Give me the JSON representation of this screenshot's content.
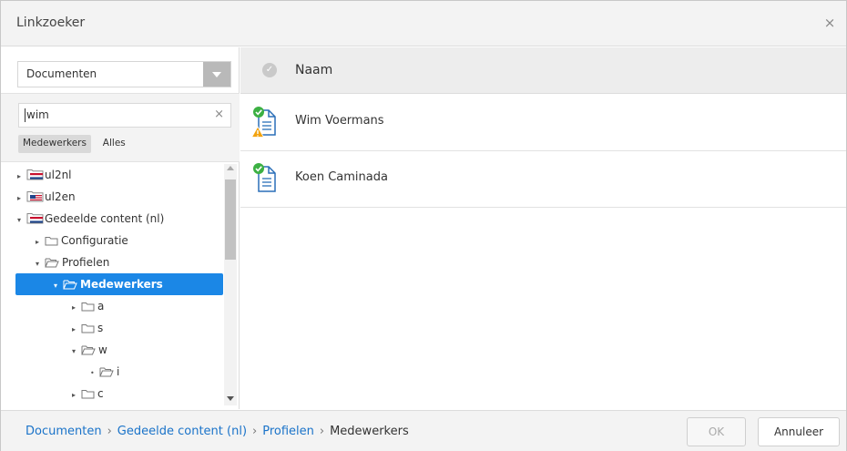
{
  "dialog": {
    "title": "Linkzoeker",
    "close_glyph": "×"
  },
  "left": {
    "select_value": "Documenten",
    "search_value": "wim",
    "clear_glyph": "×",
    "filters": [
      {
        "label": "Medewerkers",
        "active": true
      },
      {
        "label": "Alles",
        "active": false
      }
    ],
    "tree": [
      {
        "label": "ul2nl",
        "depth": 0,
        "toggle": "▸",
        "icon": "flag-nl-icon"
      },
      {
        "label": "ul2en",
        "depth": 0,
        "toggle": "▸",
        "icon": "flag-us-icon"
      },
      {
        "label": "Gedeelde content (nl)",
        "depth": 0,
        "toggle": "▾",
        "icon": "flag-nl-icon"
      },
      {
        "label": "Configuratie",
        "depth": 1,
        "toggle": "▸",
        "icon": "folder-icon"
      },
      {
        "label": "Profielen",
        "depth": 1,
        "toggle": "▾",
        "icon": "folder-open-icon"
      },
      {
        "label": "Medewerkers",
        "depth": 2,
        "toggle": "▾",
        "icon": "folder-open-icon",
        "selected": true
      },
      {
        "label": "a",
        "depth": 3,
        "toggle": "▸",
        "icon": "folder-icon"
      },
      {
        "label": "s",
        "depth": 3,
        "toggle": "▸",
        "icon": "folder-icon"
      },
      {
        "label": "w",
        "depth": 3,
        "toggle": "▾",
        "icon": "folder-open-icon"
      },
      {
        "label": "i",
        "depth": 4,
        "toggle": "•",
        "icon": "folder-open-icon"
      },
      {
        "label": "c",
        "depth": 3,
        "toggle": "▸",
        "icon": "folder-icon"
      }
    ]
  },
  "right": {
    "header_label": "Naam",
    "header_check_glyph": "✓",
    "rows": [
      {
        "name": "Wim Voermans",
        "warning": true
      },
      {
        "name": "Koen Caminada",
        "warning": false
      }
    ]
  },
  "footer": {
    "breadcrumbs": [
      "Documenten",
      "Gedeelde content (nl)",
      "Profielen",
      "Medewerkers"
    ],
    "separator": "›",
    "ok_label": "OK",
    "cancel_label": "Annuleer"
  },
  "colors": {
    "accent": "#1b87e6",
    "link": "#1a73c9",
    "check_green": "#3cb043",
    "warning": "#f2a30f",
    "flag_red": "#c8102e",
    "flag_blue": "#21468b"
  }
}
